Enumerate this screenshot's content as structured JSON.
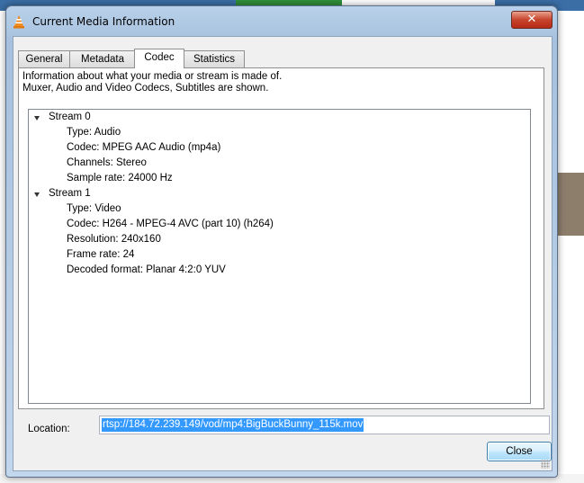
{
  "window": {
    "title": "Current Media Information",
    "close_glyph": "✕"
  },
  "tabs": [
    {
      "label": "General",
      "active": false
    },
    {
      "label": "Metadata",
      "active": false
    },
    {
      "label": "Codec",
      "active": true
    },
    {
      "label": "Statistics",
      "active": false
    }
  ],
  "info": {
    "line1": "Information about what your media or stream is made of.",
    "line2": "Muxer, Audio and Video Codecs, Subtitles are shown."
  },
  "tree": {
    "streams": [
      {
        "label": "Stream 0",
        "expanded": true,
        "properties": [
          "Type: Audio",
          "Codec: MPEG AAC Audio (mp4a)",
          "Channels: Stereo",
          "Sample rate: 24000 Hz"
        ]
      },
      {
        "label": "Stream 1",
        "expanded": true,
        "properties": [
          "Type: Video",
          "Codec: H264 - MPEG-4 AVC (part 10) (h264)",
          "Resolution: 240x160",
          "Frame rate: 24",
          "Decoded format: Planar 4:2:0 YUV"
        ]
      }
    ]
  },
  "location": {
    "label": "Location:",
    "value": "rtsp://184.72.239.149/vod/mp4:BigBuckBunny_115k.mov"
  },
  "buttons": {
    "close": "Close"
  },
  "colors": {
    "selection": "#3399ff",
    "titlebar": "#b9d1ea",
    "close_button": "#c7442c"
  }
}
